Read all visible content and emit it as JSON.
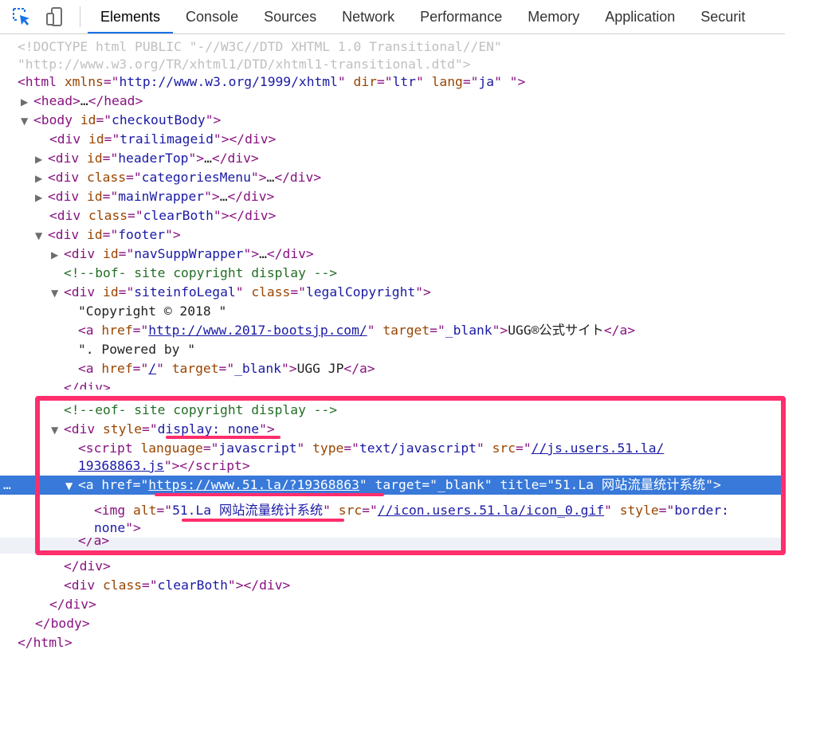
{
  "toolbar": {
    "tabs": [
      {
        "label": "Elements",
        "active": true
      },
      {
        "label": "Console",
        "active": false
      },
      {
        "label": "Sources",
        "active": false
      },
      {
        "label": "Network",
        "active": false
      },
      {
        "label": "Performance",
        "active": false
      },
      {
        "label": "Memory",
        "active": false
      },
      {
        "label": "Application",
        "active": false
      },
      {
        "label": "Securit",
        "active": false
      }
    ],
    "icons": [
      "inspect-element-icon",
      "device-toolbar-icon"
    ]
  },
  "colors": {
    "selected_row": "#3879d9",
    "annotation": "#ff2e6c",
    "tag": "#881280",
    "attribute": "#994500",
    "value": "#1a1aa6",
    "comment": "#236e25"
  },
  "dom": {
    "doctype_1": "<!DOCTYPE html PUBLIC \"-//W3C//DTD XHTML 1.0 Transitional//EN\"",
    "doctype_2": "\"http://www.w3.org/TR/xhtml1/DTD/xhtml1-transitional.dtd\">",
    "html_xmlns": "http://www.w3.org/1999/xhtml",
    "html_dir": "ltr",
    "html_lang": "ja",
    "body_id": "checkoutBody",
    "div_trailimageid": "trailimageid",
    "div_headertop": "headerTop",
    "div_categoriesmenu": "categoriesMenu",
    "div_mainwrapper": "mainWrapper",
    "div_clearboth": "clearBoth",
    "div_footer": "footer",
    "div_navsupp": "navSuppWrapper",
    "comment_bof": "<!--bof- site copyright display -->",
    "div_siteinfo_id": "siteinfoLegal",
    "div_siteinfo_class": "legalCopyright",
    "text_copyright": "\"Copyright © 2018 \"",
    "a1_href": "http://www.2017-bootsjp.com/",
    "a1_target": "_blank",
    "a1_text": "UGG®公式サイト",
    "text_powered": "\". Powered by \"",
    "a2_href": "/",
    "a2_target": "_blank",
    "a2_text": "UGG JP",
    "comment_eof": "<!--eof- site copyright display -->",
    "div_style": "display: none",
    "script_language": "javascript",
    "script_type": "text/javascript",
    "script_src_1": "//js.users.51.la/",
    "script_src_2": "19368863.js",
    "a3_href": "https://www.51.la/?19368863",
    "a3_target": "_blank",
    "a3_title": "51.La 网站流量统计系统",
    "img_alt": "51.La 网站流量统计系统",
    "img_src": "//icon.users.51.la/icon_0.gif",
    "img_style_attr": "border:",
    "img_style_cont": "none",
    "div_clearboth_2": "clearBoth",
    "selected_marker": "…"
  }
}
